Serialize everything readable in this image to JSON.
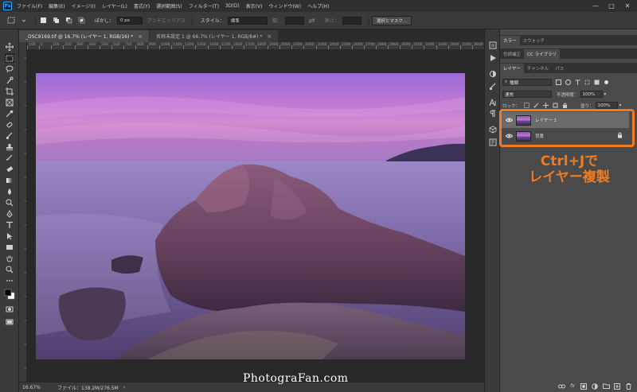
{
  "app": {
    "logo_text": "Ps"
  },
  "menu": [
    "ファイル(F)",
    "編集(E)",
    "イメージ(I)",
    "レイヤー(L)",
    "書式(Y)",
    "選択範囲(S)",
    "フィルター(T)",
    "3D(D)",
    "表示(V)",
    "ウィンドウ(W)",
    "ヘルプ(H)"
  ],
  "window_controls": [
    "—",
    "□",
    "✕"
  ],
  "options_bar": {
    "feather_label": "ぼかし：",
    "feather_value": "0 px",
    "antialias_label": "アンチエイリアス",
    "style_label": "スタイル：",
    "style_value": "標準",
    "width_label": "幅：",
    "height_label": "高さ：",
    "select_mask_button": "選択とマスク..."
  },
  "doc_tabs": [
    {
      "label": "_DSC9169.tif @ 16.7% (レイヤー 1, RGB/16) *",
      "close": "×"
    },
    {
      "label": "名称未設定 1 @ 66.7% (レイヤー 1, RGB/8#) *",
      "close": "×"
    }
  ],
  "ruler_ticks": [
    "100",
    "0",
    "100",
    "200",
    "300",
    "400",
    "500",
    "600",
    "700",
    "800",
    "900",
    "1000",
    "1100",
    "1200",
    "1300",
    "1400",
    "1500",
    "1600",
    "1700",
    "1800",
    "1900",
    "2000",
    "2100",
    "2200",
    "2300",
    "2400",
    "2500",
    "2600",
    "2700",
    "2800",
    "2900",
    "3000",
    "3100",
    "3200",
    "3300",
    "3400",
    "3500",
    "3600"
  ],
  "status_bar": {
    "zoom": "16.67%",
    "file_info": "ファイル：138.2M/276.5M",
    "arrow": "›"
  },
  "watermark": "PhotograFan.com",
  "panels": {
    "color_tabs": [
      "カラー",
      "スウォッチ"
    ],
    "adjust_tabs": [
      "色調補正",
      "CC ライブラリ"
    ],
    "layer_tabs": [
      "レイヤー",
      "チャンネル",
      "パス"
    ],
    "filter_kind": "種類",
    "blend_mode": "通常",
    "opacity_label": "不透明度：",
    "opacity_value": "100%",
    "lock_label": "ロック：",
    "fill_label": "塗り：",
    "fill_value": "100%",
    "layers": [
      {
        "name": "レイヤー 1",
        "selected": true
      },
      {
        "name": "背景",
        "selected": false,
        "locked": true
      }
    ]
  },
  "annotation": {
    "line1": "Ctrl+Jで",
    "line2": "レイヤー複製",
    "color": "#f07b20"
  },
  "colors": {
    "menubar": "#2f2f2f",
    "panel": "#4a4a4a",
    "canvas_bg": "#282828",
    "accent": "#f07b20"
  }
}
